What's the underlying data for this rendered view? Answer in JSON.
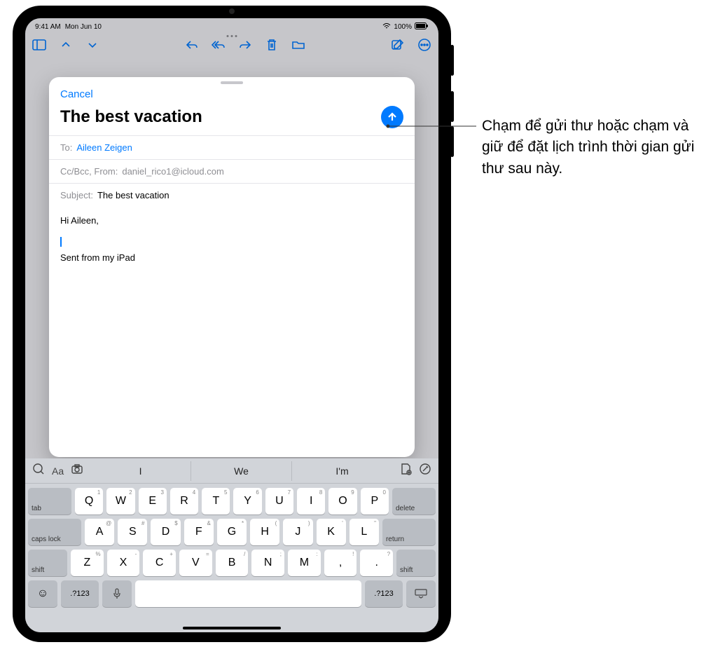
{
  "status": {
    "time": "9:41 AM",
    "date": "Mon Jun 10",
    "battery": "100%"
  },
  "toolbar_icons": [
    "sidebar",
    "up",
    "down",
    "reply",
    "reply-all",
    "forward",
    "trash",
    "folder",
    "compose",
    "more"
  ],
  "compose": {
    "cancel": "Cancel",
    "title": "The best vacation",
    "to_label": "To:",
    "to_value": "Aileen Zeigen",
    "cc_label": "Cc/Bcc, From:",
    "cc_value": "daniel_rico1@icloud.com",
    "subject_label": "Subject:",
    "subject_value": "The best vacation",
    "body_greeting": "Hi Aileen,",
    "body_signature": "Sent from my iPad"
  },
  "predictions": [
    "I",
    "We",
    "I'm"
  ],
  "keyboard": {
    "row1": [
      {
        "k": "Q",
        "s": "1"
      },
      {
        "k": "W",
        "s": "2"
      },
      {
        "k": "E",
        "s": "3"
      },
      {
        "k": "R",
        "s": "4"
      },
      {
        "k": "T",
        "s": "5"
      },
      {
        "k": "Y",
        "s": "6"
      },
      {
        "k": "U",
        "s": "7"
      },
      {
        "k": "I",
        "s": "8"
      },
      {
        "k": "O",
        "s": "9"
      },
      {
        "k": "P",
        "s": "0"
      }
    ],
    "row2": [
      {
        "k": "A",
        "s": "@"
      },
      {
        "k": "S",
        "s": "#"
      },
      {
        "k": "D",
        "s": "$"
      },
      {
        "k": "F",
        "s": "&"
      },
      {
        "k": "G",
        "s": "*"
      },
      {
        "k": "H",
        "s": "("
      },
      {
        "k": "J",
        "s": ")"
      },
      {
        "k": "K",
        "s": "'"
      },
      {
        "k": "L",
        "s": "\""
      }
    ],
    "row3": [
      {
        "k": "Z",
        "s": "%"
      },
      {
        "k": "X",
        "s": "-"
      },
      {
        "k": "C",
        "s": "+"
      },
      {
        "k": "V",
        "s": "="
      },
      {
        "k": "B",
        "s": "/"
      },
      {
        "k": "N",
        "s": ";"
      },
      {
        "k": "M",
        "s": ":"
      },
      {
        "k": ",",
        "s": "!"
      },
      {
        "k": ".",
        "s": "?"
      }
    ],
    "tab": "tab",
    "delete": "delete",
    "caps": "caps lock",
    "return": "return",
    "shift": "shift",
    "mode": ".?123"
  },
  "callout_text": "Chạm để gửi thư hoặc chạm và giữ để đặt lịch trình thời gian gửi thư sau này."
}
